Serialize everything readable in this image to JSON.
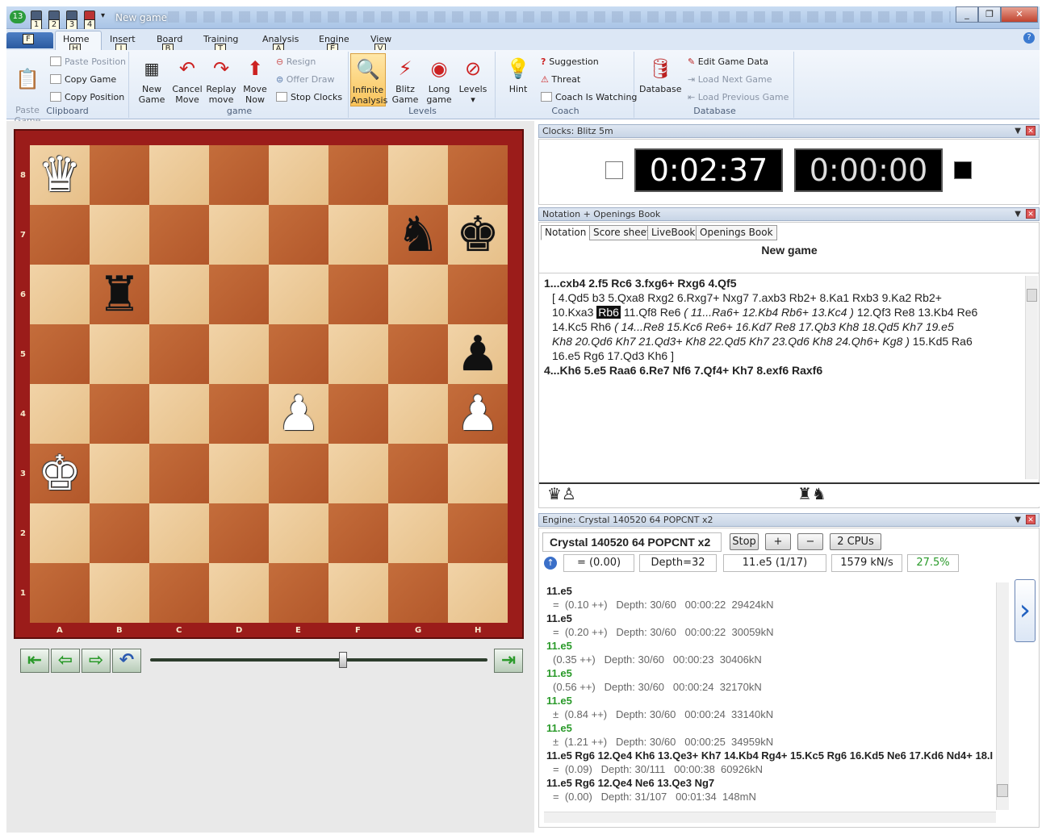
{
  "window": {
    "title": "New game",
    "app_badge": "13",
    "quick_access": [
      "1",
      "2",
      "3",
      "4"
    ]
  },
  "keytips": {
    "file": "F",
    "home": "H",
    "insert": "I",
    "board": "B",
    "training": "T",
    "analysis": "A",
    "engine": "E",
    "view": "V"
  },
  "tabs": [
    "Home",
    "Insert",
    "Board",
    "Training",
    "Analysis",
    "Engine",
    "View"
  ],
  "ribbon": {
    "clipboard": {
      "label": "Clipboard",
      "paste_game": "Paste\nGame",
      "paste_position": "Paste Position",
      "copy_game": "Copy Game",
      "copy_position": "Copy Position"
    },
    "game": {
      "label": "game",
      "new_game": "New\nGame",
      "cancel_move": "Cancel\nMove",
      "replay_move": "Replay\nmove",
      "move_now": "Move\nNow",
      "resign": "Resign",
      "offer_draw": "Offer Draw",
      "stop_clocks": "Stop Clocks"
    },
    "levels": {
      "label": "Levels",
      "infinite_analysis": "Infinite\nAnalysis",
      "blitz_game": "Blitz\nGame",
      "long_game": "Long\ngame",
      "levels": "Levels"
    },
    "coach": {
      "label": "Coach",
      "hint": "Hint",
      "suggestion": "Suggestion",
      "threat": "Threat",
      "coach_is_watching": "Coach Is Watching"
    },
    "database": {
      "label": "Database",
      "database": "Database",
      "edit_game_data": "Edit Game Data",
      "load_next_game": "Load Next Game",
      "load_previous_game": "Load Previous Game"
    }
  },
  "board": {
    "ranks": [
      "8",
      "7",
      "6",
      "5",
      "4",
      "3",
      "2",
      "1"
    ],
    "files": [
      "A",
      "B",
      "C",
      "D",
      "E",
      "F",
      "G",
      "H"
    ],
    "pieces": {
      "a8": "♛w",
      "g7": "♞b",
      "h7": "♚b",
      "b6": "♜b",
      "h5": "♟b",
      "e4": "♟w",
      "h4": "♟w",
      "a3": "♚w"
    }
  },
  "clocks": {
    "header": "Clocks: Blitz 5m",
    "white_time": "0:02:37",
    "black_time": "0:00:00"
  },
  "notation": {
    "header": "Notation + Openings Book",
    "tabs": [
      "Notation",
      "Score sheet",
      "LiveBook",
      "Openings Book"
    ],
    "title": "New game",
    "lines": [
      [
        {
          "t": "1...cxb4  2.f5  Rc6  3.fxg6+  Rxg6  4.Qf5",
          "s": "bold"
        }
      ],
      [
        {
          "t": "[ 4.Qd5  b3  5.Qxa8  Rxg2  6.Rxg7+  Nxg7  7.axb3  Rb2+  8.Ka1  Rxb3  9.Ka2  Rb2+",
          "s": ""
        }
      ],
      [
        {
          "t": "10.Kxa3 ",
          "s": ""
        },
        {
          "t": "Rb6",
          "s": "hl"
        },
        {
          "t": " 11.Qf8  Re6  ",
          "s": ""
        },
        {
          "t": "( 11...Ra6+  12.Kb4  Rb6+  13.Kc4 )",
          "s": "it"
        },
        {
          "t": " 12.Qf3  Re8  13.Kb4  Re6",
          "s": ""
        }
      ],
      [
        {
          "t": "14.Kc5  Rh6  ",
          "s": ""
        },
        {
          "t": "( 14...Re8  15.Kc6  Re6+  16.Kd7  Re8  17.Qb3  Kh8  18.Qd5  Kh7  19.e5",
          "s": "it"
        }
      ],
      [
        {
          "t": "Kh8  20.Qd6  Kh7  21.Qd3+  Kh8  22.Qd5  Kh7  23.Qd6  Kh8  24.Qh6+  Kg8 )",
          "s": "it"
        },
        {
          "t": " 15.Kd5  Ra6",
          "s": ""
        }
      ],
      [
        {
          "t": "16.e5  Rg6  17.Qd3  Kh6 ]",
          "s": ""
        }
      ],
      [
        {
          "t": "4...Kh6  5.e5  Raa6  6.Re7  Nf6  7.Qf4+  Kh7  8.exf6  Raxf6",
          "s": "bold"
        }
      ]
    ],
    "material_white": "♛♙",
    "material_black": "♜♞"
  },
  "engine": {
    "header": "Engine: Crystal 140520 64 POPCNT x2",
    "name": "Crystal 140520 64 POPCNT x2",
    "stop": "Stop",
    "plus": "+",
    "minus": "−",
    "cpus": "2 CPUs",
    "eval": "=  (0.00)",
    "depth": "Depth=32",
    "current_move": "11.e5 (1/17)",
    "speed": "1579 kN/s",
    "percent": "27.5%",
    "lines": [
      {
        "move": "11.e5",
        "green": false,
        "detail": "=  (0.10 ++)   Depth: 30/60   00:00:22  29424kN"
      },
      {
        "move": "11.e5",
        "green": false,
        "detail": "=  (0.20 ++)   Depth: 30/60   00:00:22  30059kN"
      },
      {
        "move": "11.e5",
        "green": true,
        "detail": "(0.35 ++)   Depth: 30/60   00:00:23  30406kN"
      },
      {
        "move": "11.e5",
        "green": true,
        "detail": "(0.56 ++)   Depth: 30/60   00:00:24  32170kN"
      },
      {
        "move": "11.e5",
        "green": true,
        "detail": "±  (0.84 ++)   Depth: 30/60   00:00:24  33140kN"
      },
      {
        "move": "11.e5",
        "green": true,
        "detail": "±  (1.21 ++)   Depth: 30/60   00:00:25  34959kN"
      },
      {
        "move": "11.e5 Rg6 12.Qe4 Kh6 13.Qe3+ Kh7 14.Kb4 Rg4+ 15.Kc5 Rg6 16.Kd5 Ne6 17.Kd6 Nd4+ 18.I",
        "green": false,
        "detail": "=  (0.09)   Depth: 30/111   00:00:38  60926kN"
      },
      {
        "move": "11.e5 Rg6 12.Qe4 Ne6 13.Qe3 Ng7",
        "green": false,
        "detail": "=  (0.00)   Depth: 31/107   00:01:34  148mN"
      }
    ]
  },
  "colors": {
    "board_light": "#eecb98",
    "board_dark": "#bd6333",
    "frame": "#9b1c1a",
    "accent_green": "#2a9a2a"
  }
}
